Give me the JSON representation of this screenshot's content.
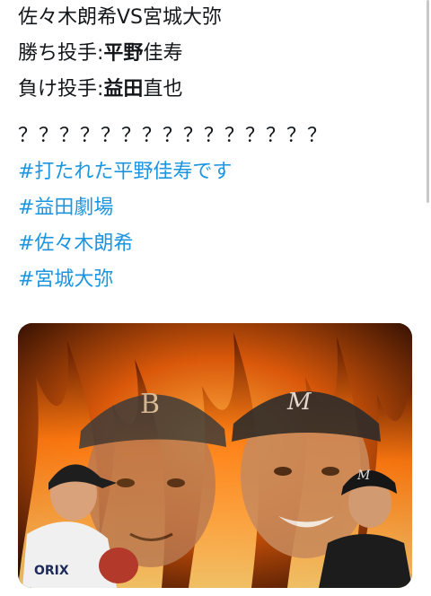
{
  "tweet": {
    "title": "佐々木朗希VS宮城大弥",
    "win_label": "勝ち投手:",
    "win_name": "平野",
    "win_name_rest": "佳寿",
    "lose_label": "負け投手:",
    "lose_name": "益田",
    "lose_name_rest": "直也",
    "question_marks": "？？？？？？？？？？？？？？？",
    "hashtags": [
      "#打たれた平野佳寿です",
      "#益田劇場",
      "#佐々木朗希",
      "#宮城大弥"
    ]
  },
  "media": {
    "description_icons": [
      "fire-background",
      "buffaloes-cap-icon",
      "marines-cap-icon"
    ],
    "colors": {
      "fire": "#ff7a10",
      "hashtag": "#1b95e0"
    }
  }
}
